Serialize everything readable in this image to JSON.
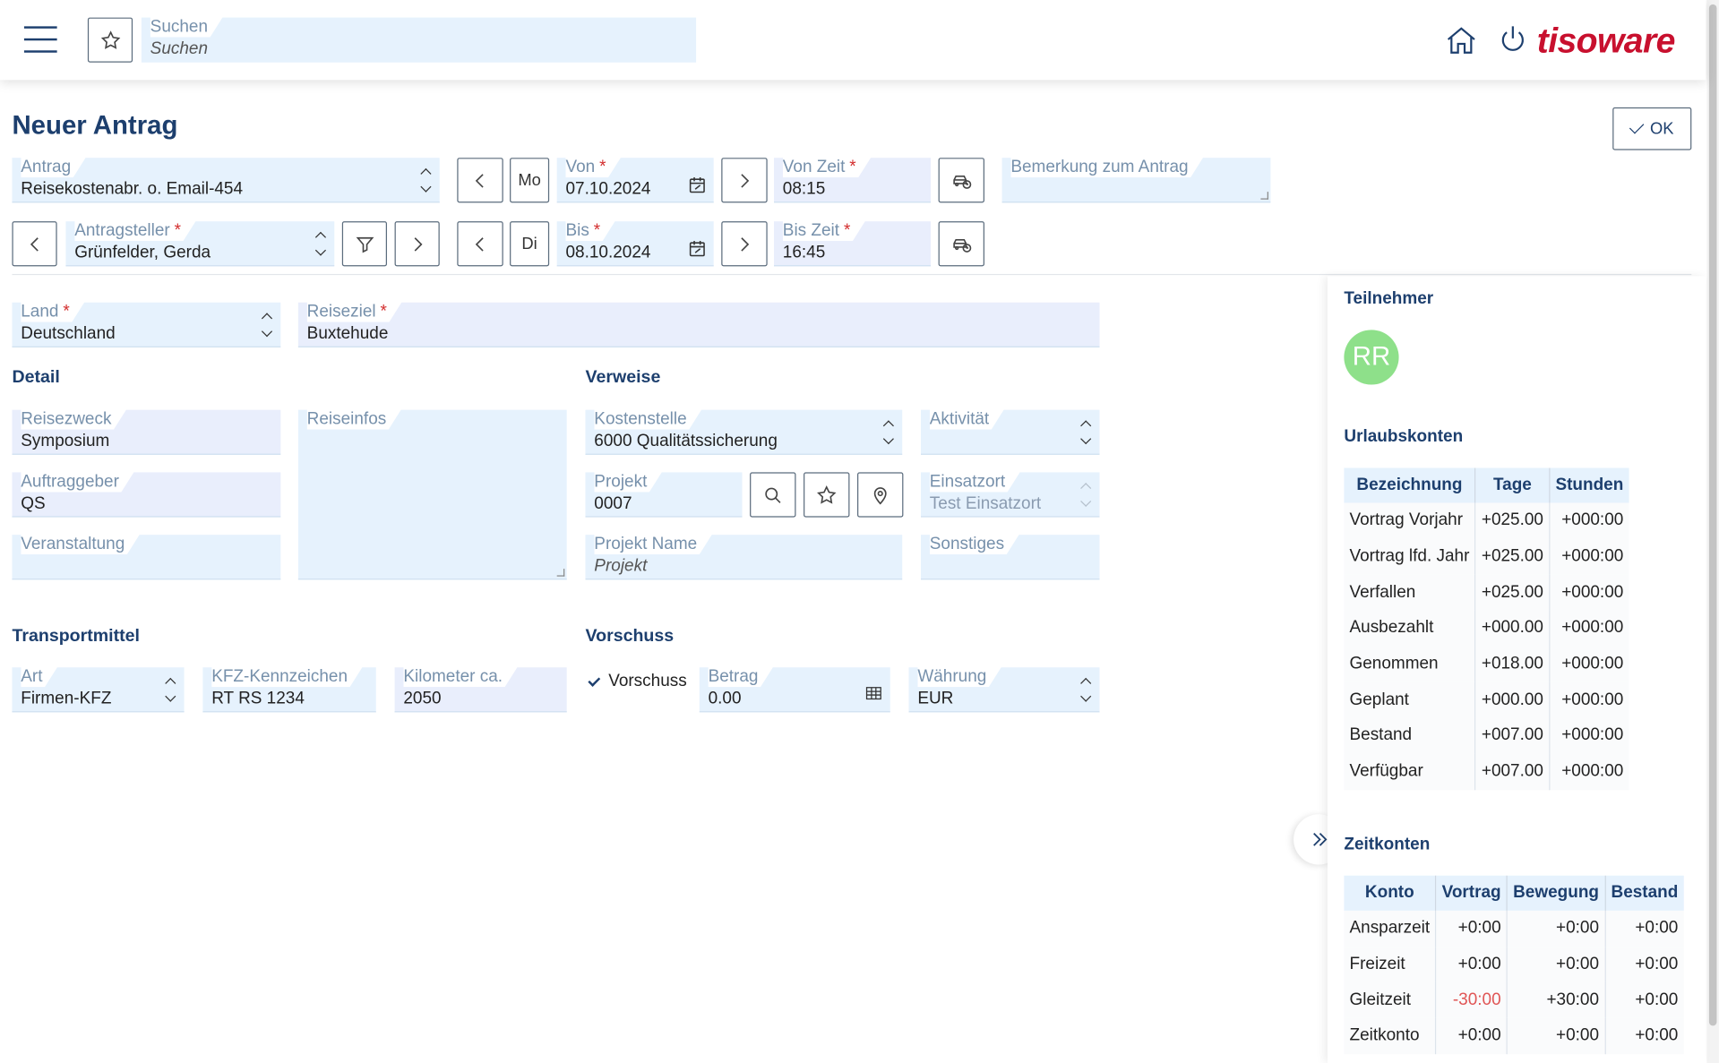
{
  "header": {
    "search_label": "Suchen",
    "search_placeholder": "Suchen",
    "logo_text": "tisoware",
    "brand_color": "#c8102e"
  },
  "page": {
    "title": "Neuer Antrag",
    "ok_label": "OK"
  },
  "form": {
    "antrag": {
      "label": "Antrag",
      "value": "Reisekostenabr. o. Email-454"
    },
    "antragsteller": {
      "label": "Antragsteller",
      "value": "Grünfelder, Gerda"
    },
    "von": {
      "day": "Mo",
      "label": "Von",
      "value": "07.10.2024"
    },
    "bis": {
      "day": "Di",
      "label": "Bis",
      "value": "08.10.2024"
    },
    "von_zeit": {
      "label": "Von Zeit",
      "value": "08:15"
    },
    "bis_zeit": {
      "label": "Bis Zeit",
      "value": "16:45"
    },
    "bemerkung": {
      "label": "Bemerkung zum Antrag",
      "value": ""
    },
    "land": {
      "label": "Land",
      "value": "Deutschland"
    },
    "reiseziel": {
      "label": "Reiseziel",
      "value": "Buxtehude"
    }
  },
  "detail": {
    "title": "Detail",
    "reisezweck": {
      "label": "Reisezweck",
      "value": "Symposium"
    },
    "auftraggeber": {
      "label": "Auftraggeber",
      "value": "QS"
    },
    "veranstaltung": {
      "label": "Veranstaltung",
      "value": ""
    },
    "reiseinfos": {
      "label": "Reiseinfos",
      "value": ""
    }
  },
  "verweise": {
    "title": "Verweise",
    "kostenstelle": {
      "label": "Kostenstelle",
      "value": "6000 Qualitätssicherung"
    },
    "aktivitaet": {
      "label": "Aktivität",
      "value": ""
    },
    "projekt": {
      "label": "Projekt",
      "value": "0007"
    },
    "einsatzort": {
      "label": "Einsatzort",
      "value": "Test Einsatzort"
    },
    "projekt_name": {
      "label": "Projekt Name",
      "placeholder": "Projekt"
    },
    "sonstiges": {
      "label": "Sonstiges",
      "value": ""
    }
  },
  "transport": {
    "title": "Transportmittel",
    "art": {
      "label": "Art",
      "value": "Firmen-KFZ"
    },
    "kfz": {
      "label": "KFZ-Kennzeichen",
      "value": "RT RS 1234"
    },
    "km": {
      "label": "Kilometer ca.",
      "value": "2050"
    }
  },
  "vorschuss": {
    "title": "Vorschuss",
    "checkbox_label": "Vorschuss",
    "checked": true,
    "betrag": {
      "label": "Betrag",
      "value": "0.00"
    },
    "waehrung": {
      "label": "Währung",
      "value": "EUR"
    }
  },
  "side": {
    "teilnehmer_title": "Teilnehmer",
    "avatar_initials": "RR",
    "avatar_color": "#8ee08a",
    "urlaub_title": "Urlaubskonten",
    "urlaub_headers": [
      "Bezeichnung",
      "Tage",
      "Stunden"
    ],
    "urlaub_rows": [
      [
        "Vortrag Vorjahr",
        "+025.00",
        "+000:00"
      ],
      [
        "Vortrag lfd. Jahr",
        "+025.00",
        "+000:00"
      ],
      [
        "Verfallen",
        "+025.00",
        "+000:00"
      ],
      [
        "Ausbezahlt",
        "+000.00",
        "+000:00"
      ],
      [
        "Genommen",
        "+018.00",
        "+000:00"
      ],
      [
        "Geplant",
        "+000.00",
        "+000:00"
      ],
      [
        "Bestand",
        "+007.00",
        "+000:00"
      ],
      [
        "Verfügbar",
        "+007.00",
        "+000:00"
      ]
    ],
    "zeit_title": "Zeitkonten",
    "zeit_headers": [
      "Konto",
      "Vortrag",
      "Bewegung",
      "Bestand"
    ],
    "zeit_rows": [
      [
        "Ansparzeit",
        "+0:00",
        "+0:00",
        "+0:00"
      ],
      [
        "Freizeit",
        "+0:00",
        "+0:00",
        "+0:00"
      ],
      [
        "Gleitzeit",
        "-30:00",
        "+30:00",
        "+0:00"
      ],
      [
        "Zeitkonto",
        "+0:00",
        "+0:00",
        "+0:00"
      ]
    ]
  }
}
